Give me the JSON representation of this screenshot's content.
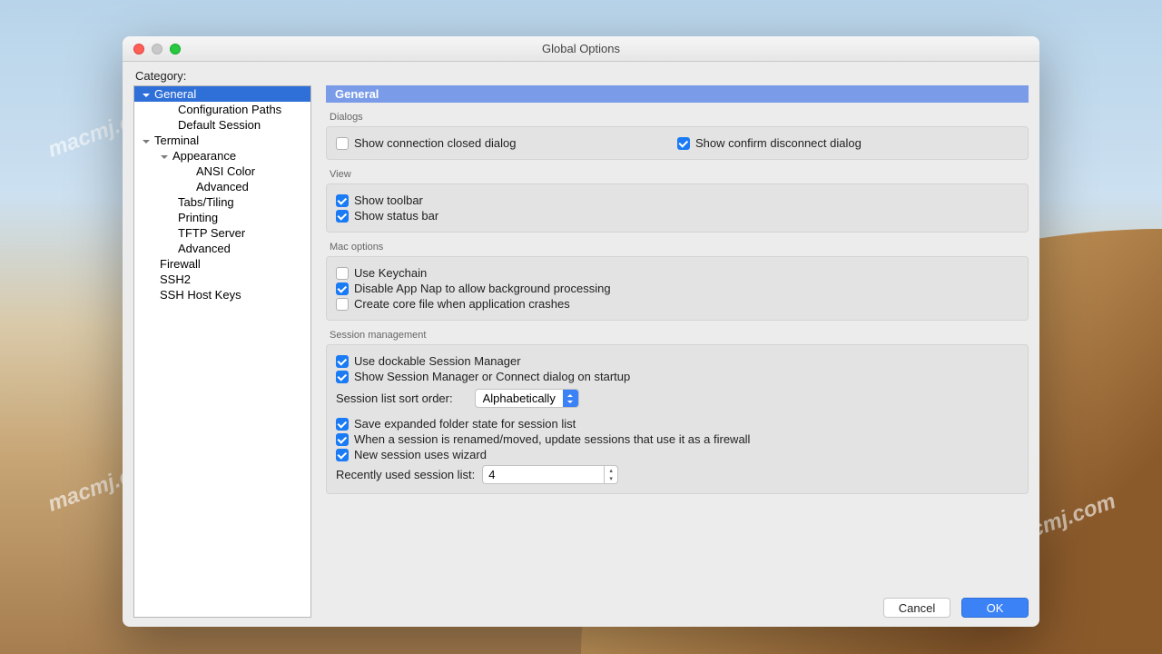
{
  "window": {
    "title": "Global Options"
  },
  "category_label": "Category:",
  "tree": {
    "general": "General",
    "configuration_paths": "Configuration Paths",
    "default_session": "Default Session",
    "terminal": "Terminal",
    "appearance": "Appearance",
    "ansi_color": "ANSI Color",
    "advanced_appearance": "Advanced",
    "tabs_tiling": "Tabs/Tiling",
    "printing": "Printing",
    "tftp_server": "TFTP Server",
    "advanced_terminal": "Advanced",
    "firewall": "Firewall",
    "ssh2": "SSH2",
    "ssh_host_keys": "SSH Host Keys"
  },
  "panel": {
    "title": "General"
  },
  "sections": {
    "dialogs": {
      "label": "Dialogs",
      "show_conn_closed": "Show connection closed dialog",
      "show_confirm_disconnect": "Show confirm disconnect dialog"
    },
    "view": {
      "label": "View",
      "show_toolbar": "Show toolbar",
      "show_statusbar": "Show status bar"
    },
    "mac": {
      "label": "Mac options",
      "use_keychain": "Use Keychain",
      "disable_app_nap": "Disable App Nap to allow background processing",
      "create_core": "Create core file when application crashes"
    },
    "session": {
      "label": "Session management",
      "dockable": "Use dockable Session Manager",
      "show_on_startup": "Show Session Manager or Connect dialog on startup",
      "sort_label": "Session list sort order:",
      "sort_value": "Alphabetically",
      "save_expanded": "Save expanded folder state for session list",
      "renamed_moved": "When a session is renamed/moved, update sessions that use it as a firewall",
      "new_wizard": "New session uses wizard",
      "recent_label": "Recently used session list:",
      "recent_value": "4"
    }
  },
  "buttons": {
    "cancel": "Cancel",
    "ok": "OK"
  }
}
